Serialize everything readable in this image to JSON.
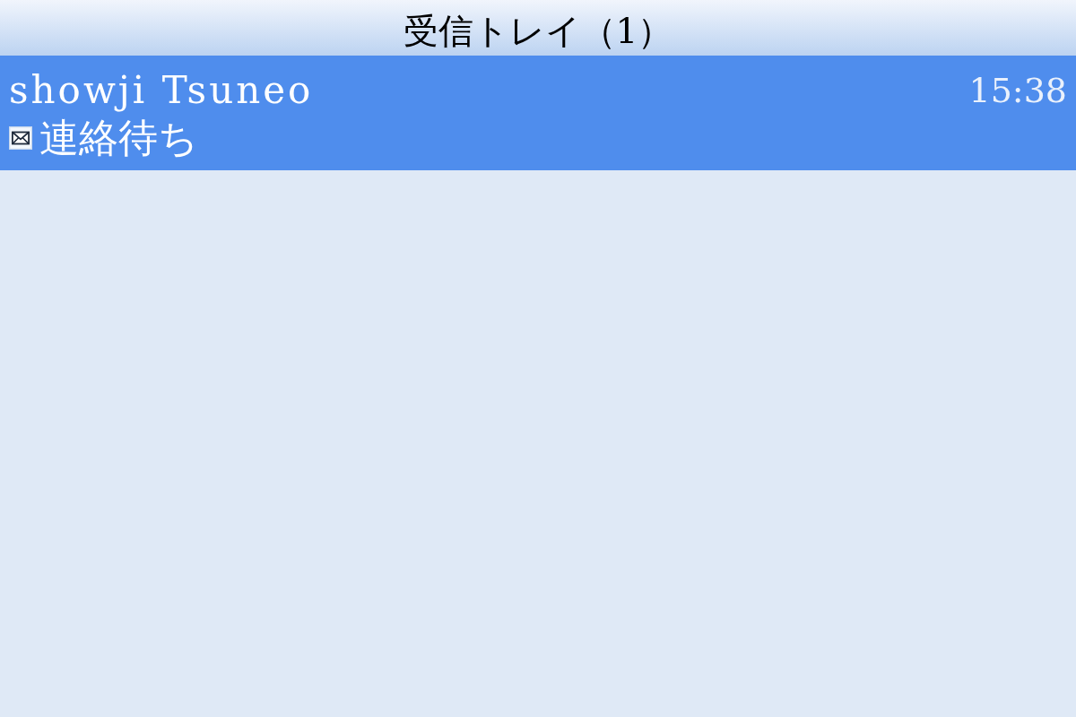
{
  "header": {
    "title": "受信トレイ（1）"
  },
  "messages": [
    {
      "sender": "showji Tsuneo",
      "time": "15:38",
      "subject": "連絡待ち",
      "unread": true,
      "selected": true
    }
  ]
}
